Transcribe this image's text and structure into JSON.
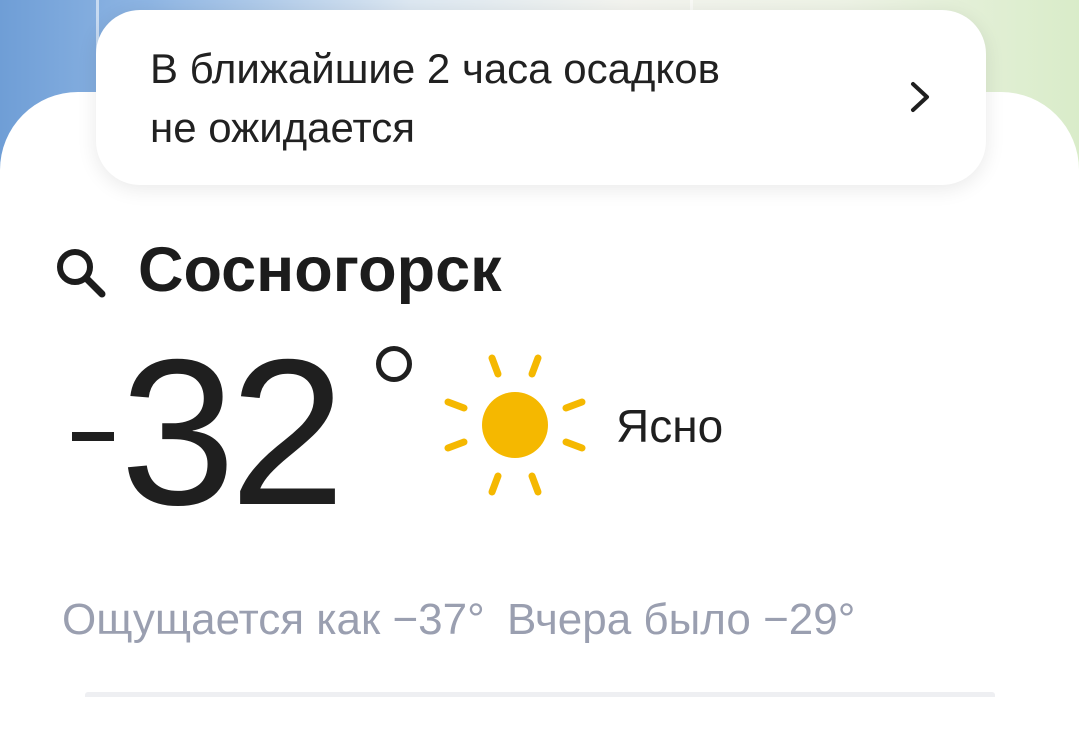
{
  "precipitation": {
    "line1": "В ближайшие 2 часа осадков",
    "line2": "не ожидается"
  },
  "location": {
    "city": "Сосногорск"
  },
  "current": {
    "temperature": "32",
    "condition": "Ясно",
    "condition_icon": "sun-icon"
  },
  "details": {
    "feels_like": "Ощущается как −37°",
    "yesterday": "Вчера было −29°"
  },
  "colors": {
    "sun": "#f5b800",
    "secondary_text": "#9a9fb0",
    "map_water": "#6f9ed6"
  }
}
